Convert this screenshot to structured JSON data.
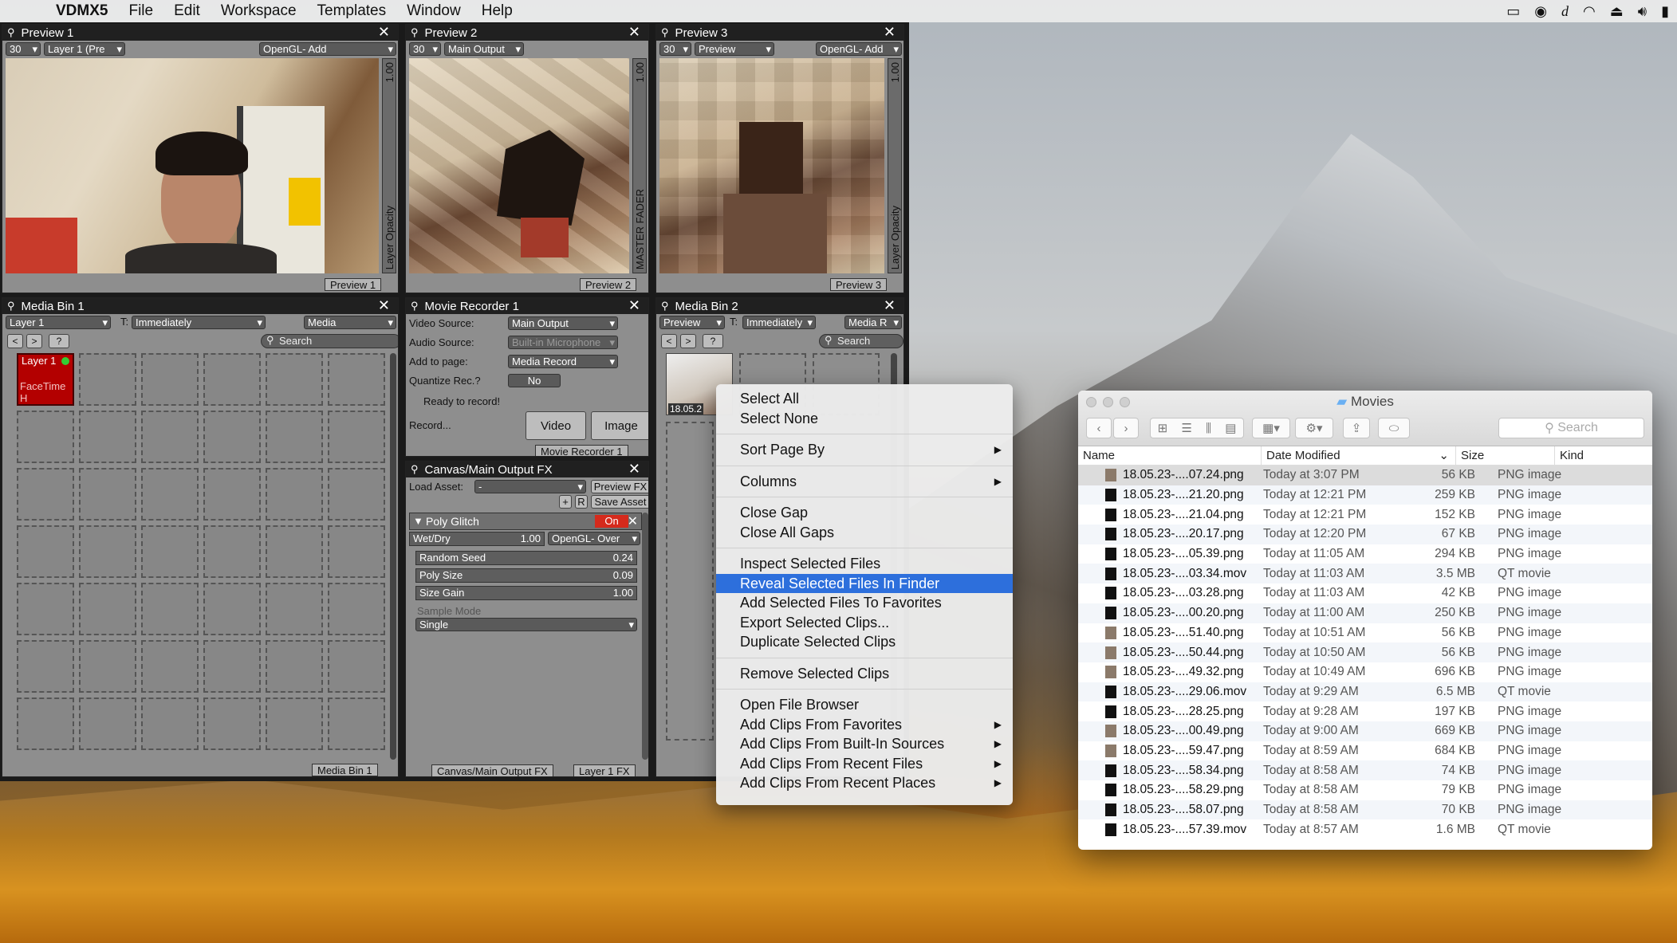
{
  "menubar": {
    "app": "VDMX5",
    "items": [
      "File",
      "Edit",
      "Workspace",
      "Templates",
      "Window",
      "Help"
    ]
  },
  "preview1": {
    "title": "Preview 1",
    "fps": "30",
    "layer": "Layer 1 (Pre",
    "blend": "OpenGL- Add",
    "value": "1.00",
    "fader": "Layer Opacity",
    "tab": "Preview 1"
  },
  "preview2": {
    "title": "Preview 2",
    "fps": "30",
    "source": "Main Output",
    "value": "1.00",
    "fader": "MASTER FADER",
    "tab": "Preview 2"
  },
  "preview3": {
    "title": "Preview 3",
    "fps": "30",
    "source": "Preview",
    "blend": "OpenGL- Add",
    "value": "1.00",
    "fader": "Layer Opacity",
    "tab": "Preview 3"
  },
  "mediabin1": {
    "title": "Media Bin 1",
    "layer": "Layer 1",
    "trigger_label": "T:",
    "trigger": "Immediately",
    "media": "Media",
    "nav": [
      "<",
      ">",
      "?"
    ],
    "search": "Search",
    "clip_title": "Layer 1",
    "clip_sub": "FaceTime H",
    "tab": "Media Bin 1"
  },
  "recorder": {
    "title": "Movie Recorder 1",
    "video_label": "Video Source:",
    "video": "Main Output",
    "audio_label": "Audio Source:",
    "audio": "Built-in Microphone",
    "page_label": "Add to page:",
    "page": "Media Record",
    "quantize_label": "Quantize Rec.?",
    "quantize": "No",
    "status": "Ready to record!",
    "record_label": "Record...",
    "video_btn": "Video",
    "image_btn": "Image",
    "tab": "Movie Recorder 1"
  },
  "fx": {
    "title": "Canvas/Main Output FX",
    "load_label": "Load Asset:",
    "load": "-",
    "preview_btn": "Preview FX",
    "plus": "+",
    "r": "R",
    "save": "Save Asset",
    "effect": "Poly Glitch",
    "on": "On",
    "wetdry_label": "Wet/Dry",
    "wetdry": "1.00",
    "blend": "OpenGL- Over",
    "params": [
      {
        "label": "Random Seed",
        "value": "0.24"
      },
      {
        "label": "Poly Size",
        "value": "0.09"
      },
      {
        "label": "Size Gain",
        "value": "1.00"
      }
    ],
    "mode_label": "Sample Mode",
    "mode": "Single",
    "tab": "Canvas/Main Output FX",
    "tab2": "Layer 1 FX"
  },
  "mediabin2": {
    "title": "Media Bin 2",
    "source": "Preview",
    "trigger_label": "T:",
    "trigger": "Immediately",
    "media": "Media R",
    "nav": [
      "<",
      ">",
      "?"
    ],
    "search": "Search",
    "clip_label": "18.05.2"
  },
  "context_menu": [
    {
      "label": "Select All"
    },
    {
      "label": "Select None"
    },
    {
      "sep": true
    },
    {
      "label": "Sort Page By",
      "sub": true
    },
    {
      "sep": true
    },
    {
      "label": "Columns",
      "sub": true
    },
    {
      "sep": true
    },
    {
      "label": "Close Gap"
    },
    {
      "label": "Close All Gaps"
    },
    {
      "sep": true
    },
    {
      "label": "Inspect Selected Files"
    },
    {
      "label": "Reveal Selected Files In Finder",
      "selected": true
    },
    {
      "label": "Add Selected Files To Favorites"
    },
    {
      "label": "Export Selected Clips..."
    },
    {
      "label": "Duplicate Selected Clips"
    },
    {
      "sep": true
    },
    {
      "label": "Remove Selected Clips"
    },
    {
      "sep": true
    },
    {
      "label": "Open File Browser"
    },
    {
      "label": "Add Clips From Favorites",
      "sub": true
    },
    {
      "label": "Add Clips From Built-In Sources",
      "sub": true
    },
    {
      "label": "Add Clips From Recent Files",
      "sub": true
    },
    {
      "label": "Add Clips From Recent Places",
      "sub": true
    }
  ],
  "finder": {
    "title": "Movies",
    "search": "Search",
    "columns": [
      "Name",
      "Date Modified",
      "Size",
      "Kind"
    ],
    "rows": [
      {
        "name": "18.05.23-....07.24.png",
        "date": "Today at 3:07 PM",
        "size": "56 KB",
        "kind": "PNG image"
      },
      {
        "name": "18.05.23-....21.20.png",
        "date": "Today at 12:21 PM",
        "size": "259 KB",
        "kind": "PNG image"
      },
      {
        "name": "18.05.23-....21.04.png",
        "date": "Today at 12:21 PM",
        "size": "152 KB",
        "kind": "PNG image"
      },
      {
        "name": "18.05.23-....20.17.png",
        "date": "Today at 12:20 PM",
        "size": "67 KB",
        "kind": "PNG image"
      },
      {
        "name": "18.05.23-....05.39.png",
        "date": "Today at 11:05 AM",
        "size": "294 KB",
        "kind": "PNG image"
      },
      {
        "name": "18.05.23-....03.34.mov",
        "date": "Today at 11:03 AM",
        "size": "3.5 MB",
        "kind": "QT movie"
      },
      {
        "name": "18.05.23-....03.28.png",
        "date": "Today at 11:03 AM",
        "size": "42 KB",
        "kind": "PNG image"
      },
      {
        "name": "18.05.23-....00.20.png",
        "date": "Today at 11:00 AM",
        "size": "250 KB",
        "kind": "PNG image"
      },
      {
        "name": "18.05.23-....51.40.png",
        "date": "Today at 10:51 AM",
        "size": "56 KB",
        "kind": "PNG image"
      },
      {
        "name": "18.05.23-....50.44.png",
        "date": "Today at 10:50 AM",
        "size": "56 KB",
        "kind": "PNG image"
      },
      {
        "name": "18.05.23-....49.32.png",
        "date": "Today at 10:49 AM",
        "size": "696 KB",
        "kind": "PNG image"
      },
      {
        "name": "18.05.23-....29.06.mov",
        "date": "Today at 9:29 AM",
        "size": "6.5 MB",
        "kind": "QT movie"
      },
      {
        "name": "18.05.23-....28.25.png",
        "date": "Today at 9:28 AM",
        "size": "197 KB",
        "kind": "PNG image"
      },
      {
        "name": "18.05.23-....00.49.png",
        "date": "Today at 9:00 AM",
        "size": "669 KB",
        "kind": "PNG image"
      },
      {
        "name": "18.05.23-....59.47.png",
        "date": "Today at 8:59 AM",
        "size": "684 KB",
        "kind": "PNG image"
      },
      {
        "name": "18.05.23-....58.34.png",
        "date": "Today at 8:58 AM",
        "size": "74 KB",
        "kind": "PNG image"
      },
      {
        "name": "18.05.23-....58.29.png",
        "date": "Today at 8:58 AM",
        "size": "79 KB",
        "kind": "PNG image"
      },
      {
        "name": "18.05.23-....58.07.png",
        "date": "Today at 8:58 AM",
        "size": "70 KB",
        "kind": "PNG image"
      },
      {
        "name": "18.05.23-....57.39.mov",
        "date": "Today at 8:57 AM",
        "size": "1.6 MB",
        "kind": "QT movie"
      }
    ]
  }
}
